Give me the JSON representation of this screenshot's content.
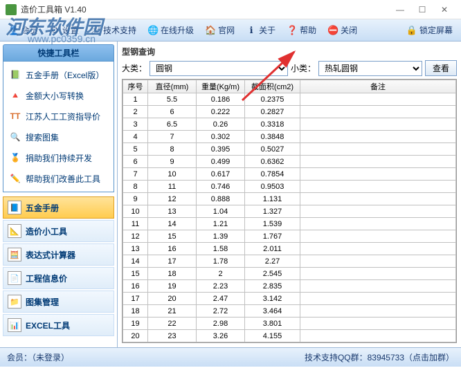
{
  "window": {
    "title": "造价工具箱 V1.40",
    "min": "—",
    "max": "☐",
    "close": "✕"
  },
  "toolbar": {
    "member": "会员",
    "settings": "设置",
    "techsupport": "技术支持",
    "upgrade": "在线升级",
    "website": "官网",
    "about": "关于",
    "help": "帮助",
    "closebtn": "关闭",
    "lock": "锁定屏幕"
  },
  "watermark": {
    "brand": "河东软件园",
    "url": "www.pc0359.cn"
  },
  "sidebar": {
    "title": "快捷工具栏",
    "shortcuts": [
      "五金手册（Excel版）",
      "金额大小写转换",
      "江苏人工工资指导价",
      "搜索图集",
      "捐助我们持续开发",
      "帮助我们改善此工具"
    ],
    "nav": [
      "五金手册",
      "造价小工具",
      "表达式计算器",
      "工程信息价",
      "图集管理",
      "EXCEL工具"
    ]
  },
  "content": {
    "title": "型钢查询",
    "cat_label": "大类：",
    "cat_value": "圆钢",
    "sub_label": "小类：",
    "sub_value": "热轧圆钢",
    "view_btn": "查看",
    "headers": [
      "序号",
      "直径(mm)",
      "重量(Kg/m)",
      "截面积(cm2)",
      "备注"
    ]
  },
  "chart_data": {
    "type": "table",
    "columns": [
      "序号",
      "直径(mm)",
      "重量(Kg/m)",
      "截面积(cm2)",
      "备注"
    ],
    "rows": [
      [
        "1",
        "5.5",
        "0.186",
        "0.2375",
        ""
      ],
      [
        "2",
        "6",
        "0.222",
        "0.2827",
        ""
      ],
      [
        "3",
        "6.5",
        "0.26",
        "0.3318",
        ""
      ],
      [
        "4",
        "7",
        "0.302",
        "0.3848",
        ""
      ],
      [
        "5",
        "8",
        "0.395",
        "0.5027",
        ""
      ],
      [
        "6",
        "9",
        "0.499",
        "0.6362",
        ""
      ],
      [
        "7",
        "10",
        "0.617",
        "0.7854",
        ""
      ],
      [
        "8",
        "11",
        "0.746",
        "0.9503",
        ""
      ],
      [
        "9",
        "12",
        "0.888",
        "1.131",
        ""
      ],
      [
        "10",
        "13",
        "1.04",
        "1.327",
        ""
      ],
      [
        "11",
        "14",
        "1.21",
        "1.539",
        ""
      ],
      [
        "12",
        "15",
        "1.39",
        "1.767",
        ""
      ],
      [
        "13",
        "16",
        "1.58",
        "2.011",
        ""
      ],
      [
        "14",
        "17",
        "1.78",
        "2.27",
        ""
      ],
      [
        "15",
        "18",
        "2",
        "2.545",
        ""
      ],
      [
        "16",
        "19",
        "2.23",
        "2.835",
        ""
      ],
      [
        "17",
        "20",
        "2.47",
        "3.142",
        ""
      ],
      [
        "18",
        "21",
        "2.72",
        "3.464",
        ""
      ],
      [
        "19",
        "22",
        "2.98",
        "3.801",
        ""
      ],
      [
        "20",
        "23",
        "3.26",
        "4.155",
        ""
      ]
    ]
  },
  "status": {
    "left": "会员：（未登录）",
    "right": "技术支持QQ群：83945733（点击加群）"
  }
}
